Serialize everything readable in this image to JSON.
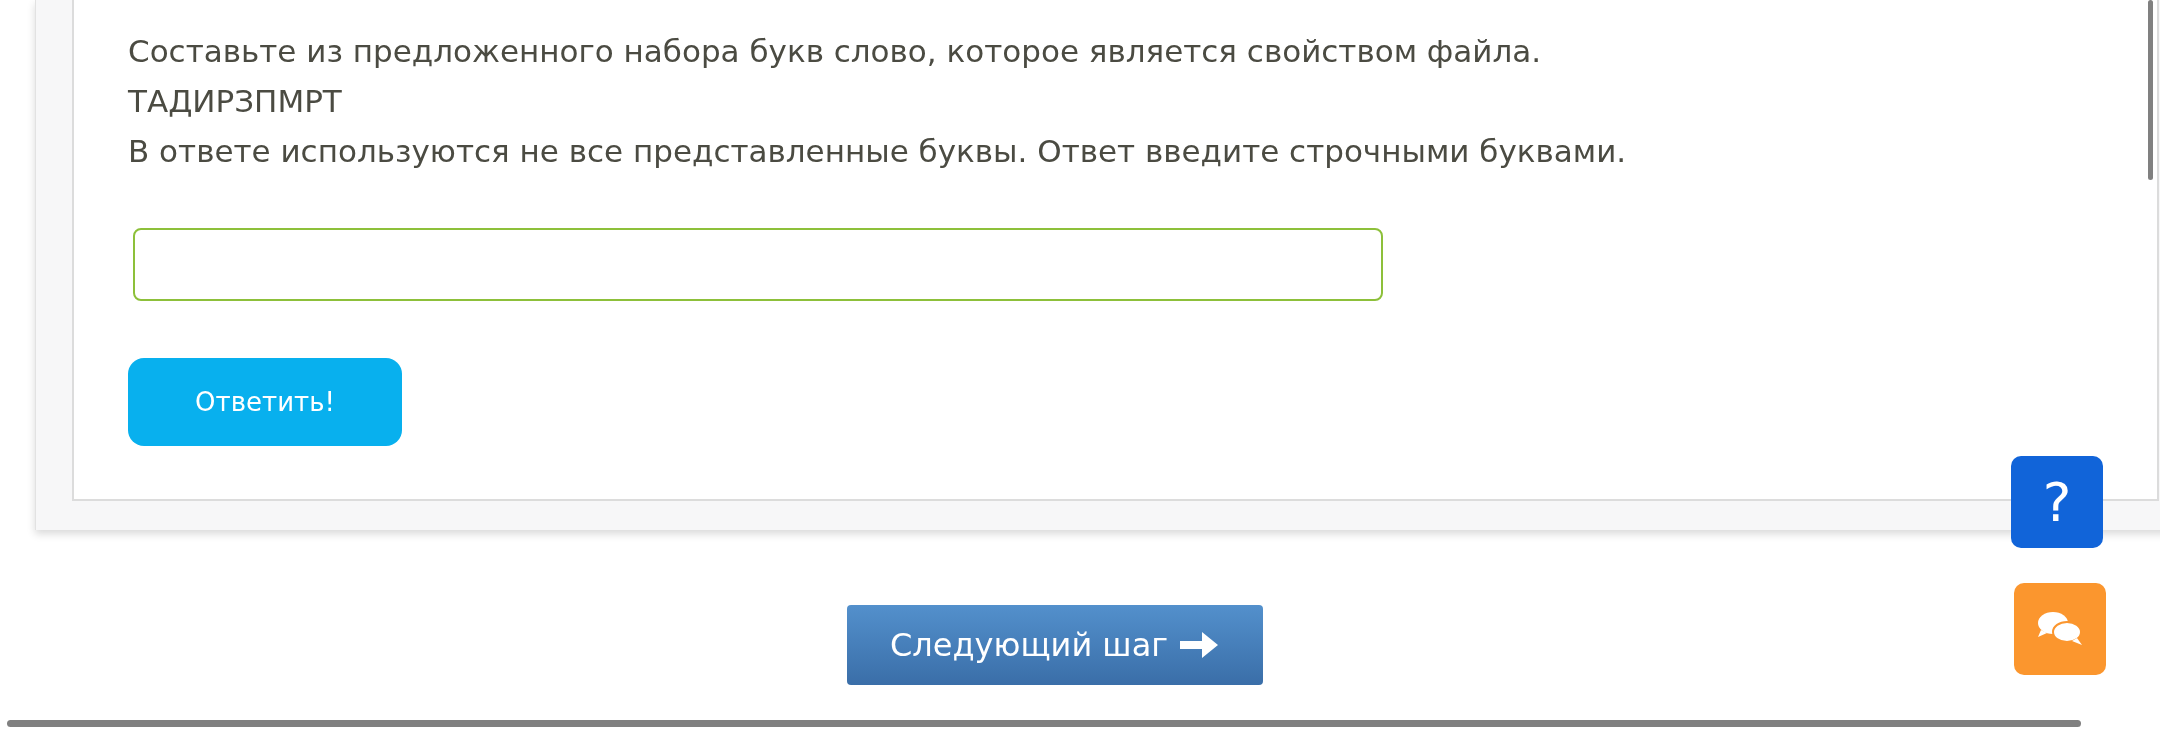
{
  "question": {
    "prompt": "Составьте из предложенного набора букв слово, которое является свойством файла.",
    "letters": "ТАДИРЗПМРТ",
    "note": "В ответе используются не все представленные буквы. Ответ введите строчными буквами."
  },
  "submit_button": {
    "label": "Ответить!"
  },
  "next_button": {
    "label": "Следующий шаг"
  },
  "help_button": {
    "label": "?"
  }
}
